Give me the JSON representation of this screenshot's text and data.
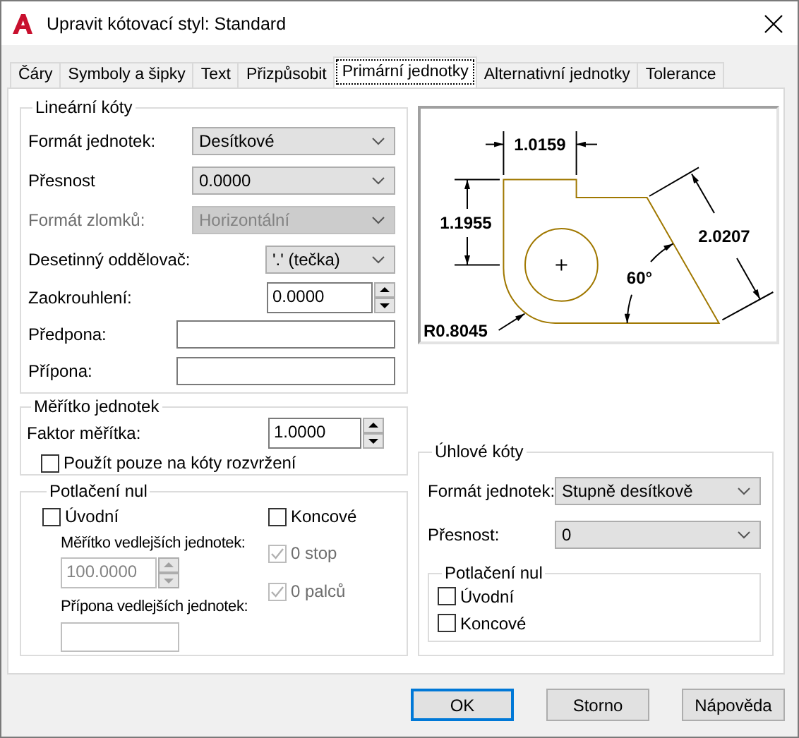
{
  "window": {
    "title": "Upravit kótovací styl: Standard"
  },
  "tabs": [
    {
      "label": "Čáry",
      "selected": false
    },
    {
      "label": "Symboly a šipky",
      "selected": false
    },
    {
      "label": "Text",
      "selected": false
    },
    {
      "label": "Přizpůsobit",
      "selected": false
    },
    {
      "label": "Primární jednotky",
      "selected": true
    },
    {
      "label": "Alternativní jednotky",
      "selected": false
    },
    {
      "label": "Tolerance",
      "selected": false
    }
  ],
  "linear_dimensions": {
    "title": "Lineární kóty",
    "fields": [
      {
        "kind": "combo",
        "label": "Formát jednotek:",
        "value": "Desítkové",
        "disabled": false
      },
      {
        "kind": "combo",
        "label": "Přesnost",
        "value": "0.0000",
        "disabled": false
      },
      {
        "kind": "combo",
        "label": "Formát zlomků:",
        "value": "Horizontální",
        "disabled": true
      },
      {
        "kind": "combo",
        "label": "Desetinný oddělovač:",
        "value": "'.' (tečka)",
        "disabled": false
      },
      {
        "kind": "spin",
        "label": "Zaokrouhlení:",
        "value": "0.0000",
        "disabled": false
      },
      {
        "kind": "text",
        "label": "Předpona:",
        "disabled": false
      },
      {
        "kind": "text",
        "label": "Přípona:",
        "disabled": false
      }
    ]
  },
  "scale": {
    "title": "Měřítko jednotek",
    "factor": {
      "label": "Faktor měřítka:",
      "value": "1.0000"
    },
    "layout_only": {
      "label": "Použít pouze na kóty rozvržení",
      "checked": false
    }
  },
  "zero_suppression": {
    "title": "Potlačení nul",
    "leading": {
      "label": "Úvodní",
      "checked": false
    },
    "trailing": {
      "label": "Koncové",
      "checked": false
    },
    "sub_units_factor": {
      "label": "Měřítko vedlejších jednotek:",
      "value": "100.0000",
      "disabled": true
    },
    "sub_units_suffix": {
      "label": "Přípona vedlejších jednotek:",
      "disabled": true
    },
    "feet": {
      "label": "0 stop",
      "checked": true,
      "disabled": true
    },
    "inches": {
      "label": "0 palců",
      "checked": true,
      "disabled": true
    }
  },
  "preview": {
    "width_dim": "1.0159",
    "height_dim": "1.1955",
    "slant_dim": "2.0207",
    "angle_dim": "60°",
    "radius_dim": "R0.8045"
  },
  "angular_dimensions": {
    "title": "Úhlové kóty",
    "format": {
      "label": "Formát jednotek:",
      "value": "Stupně desítkově"
    },
    "precision": {
      "label": "Přesnost:",
      "value": "0"
    },
    "zero_suppression": {
      "title": "Potlačení nul",
      "leading": {
        "label": "Úvodní",
        "checked": false
      },
      "trailing": {
        "label": "Koncové",
        "checked": false
      }
    }
  },
  "buttons": [
    {
      "label": "OK",
      "default": true
    },
    {
      "label": "Storno",
      "default": false
    },
    {
      "label": "Nápověda",
      "default": false
    }
  ]
}
